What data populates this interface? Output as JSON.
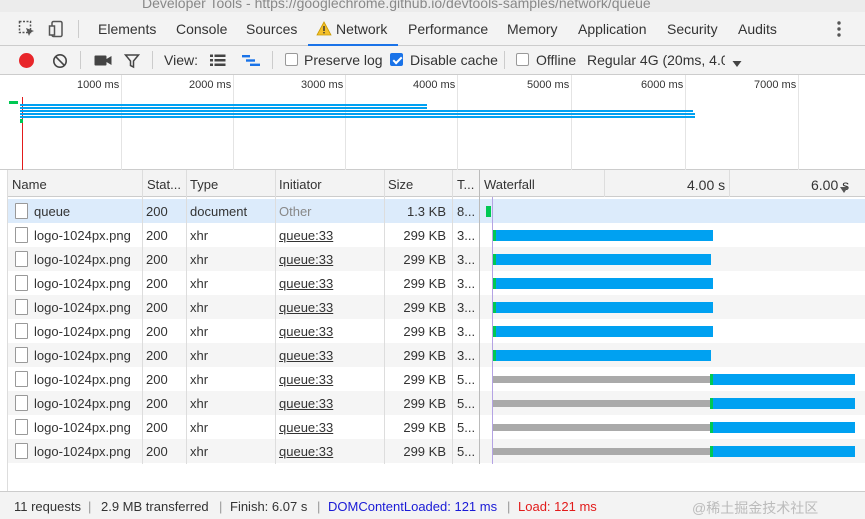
{
  "window": {
    "title": "Developer Tools - https://googlechrome.github.io/devtools-samples/network/queue"
  },
  "tabs": [
    "Elements",
    "Console",
    "Sources",
    "Network",
    "Performance",
    "Memory",
    "Application",
    "Security",
    "Audits"
  ],
  "active_tab": "Network",
  "toolbar": {
    "view_label": "View:",
    "preserve_log_label": "Preserve log",
    "preserve_log_checked": false,
    "disable_cache_label": "Disable cache",
    "disable_cache_checked": true,
    "offline_label": "Offline",
    "offline_checked": false,
    "throttle_value": "Regular 4G (20ms, 4.0"
  },
  "overview": {
    "ticks": [
      "1000 ms",
      "2000 ms",
      "3000 ms",
      "4000 ms",
      "5000 ms",
      "6000 ms",
      "7000 ms"
    ]
  },
  "columns": {
    "name": "Name",
    "status": "Stat...",
    "type": "Type",
    "initiator": "Initiator",
    "size": "Size",
    "time": "T...",
    "waterfall": "Waterfall",
    "waterfall_ticks": [
      "4.00 s",
      "6.00 s"
    ]
  },
  "rows": [
    {
      "name": "queue",
      "status": "200",
      "type": "document",
      "initiator": "Other",
      "size": "1.3 KB",
      "time": "8..."
    },
    {
      "name": "logo-1024px.png",
      "status": "200",
      "type": "xhr",
      "initiator": "queue:33",
      "size": "299 KB",
      "time": "3..."
    },
    {
      "name": "logo-1024px.png",
      "status": "200",
      "type": "xhr",
      "initiator": "queue:33",
      "size": "299 KB",
      "time": "3..."
    },
    {
      "name": "logo-1024px.png",
      "status": "200",
      "type": "xhr",
      "initiator": "queue:33",
      "size": "299 KB",
      "time": "3..."
    },
    {
      "name": "logo-1024px.png",
      "status": "200",
      "type": "xhr",
      "initiator": "queue:33",
      "size": "299 KB",
      "time": "3..."
    },
    {
      "name": "logo-1024px.png",
      "status": "200",
      "type": "xhr",
      "initiator": "queue:33",
      "size": "299 KB",
      "time": "3..."
    },
    {
      "name": "logo-1024px.png",
      "status": "200",
      "type": "xhr",
      "initiator": "queue:33",
      "size": "299 KB",
      "time": "3..."
    },
    {
      "name": "logo-1024px.png",
      "status": "200",
      "type": "xhr",
      "initiator": "queue:33",
      "size": "299 KB",
      "time": "5..."
    },
    {
      "name": "logo-1024px.png",
      "status": "200",
      "type": "xhr",
      "initiator": "queue:33",
      "size": "299 KB",
      "time": "5..."
    },
    {
      "name": "logo-1024px.png",
      "status": "200",
      "type": "xhr",
      "initiator": "queue:33",
      "size": "299 KB",
      "time": "5..."
    },
    {
      "name": "logo-1024px.png",
      "status": "200",
      "type": "xhr",
      "initiator": "queue:33",
      "size": "299 KB",
      "time": "5..."
    }
  ],
  "statusbar": {
    "requests": "11 requests",
    "transferred": "2.9 MB transferred",
    "finish": "Finish: 6.07 s",
    "dom_content_loaded": "DOMContentLoaded: 121 ms",
    "load": "Load: 121 ms"
  },
  "watermark": "@稀土掘金技术社区",
  "colors": {
    "accent": "#1a73e8",
    "record": "#e8262a",
    "bar_download": "#00a1f1",
    "bar_waiting": "#00c853",
    "bar_queued": "#aaaaaa",
    "dom_content_loaded": "#1a1ad6",
    "load": "#e21b1b"
  }
}
